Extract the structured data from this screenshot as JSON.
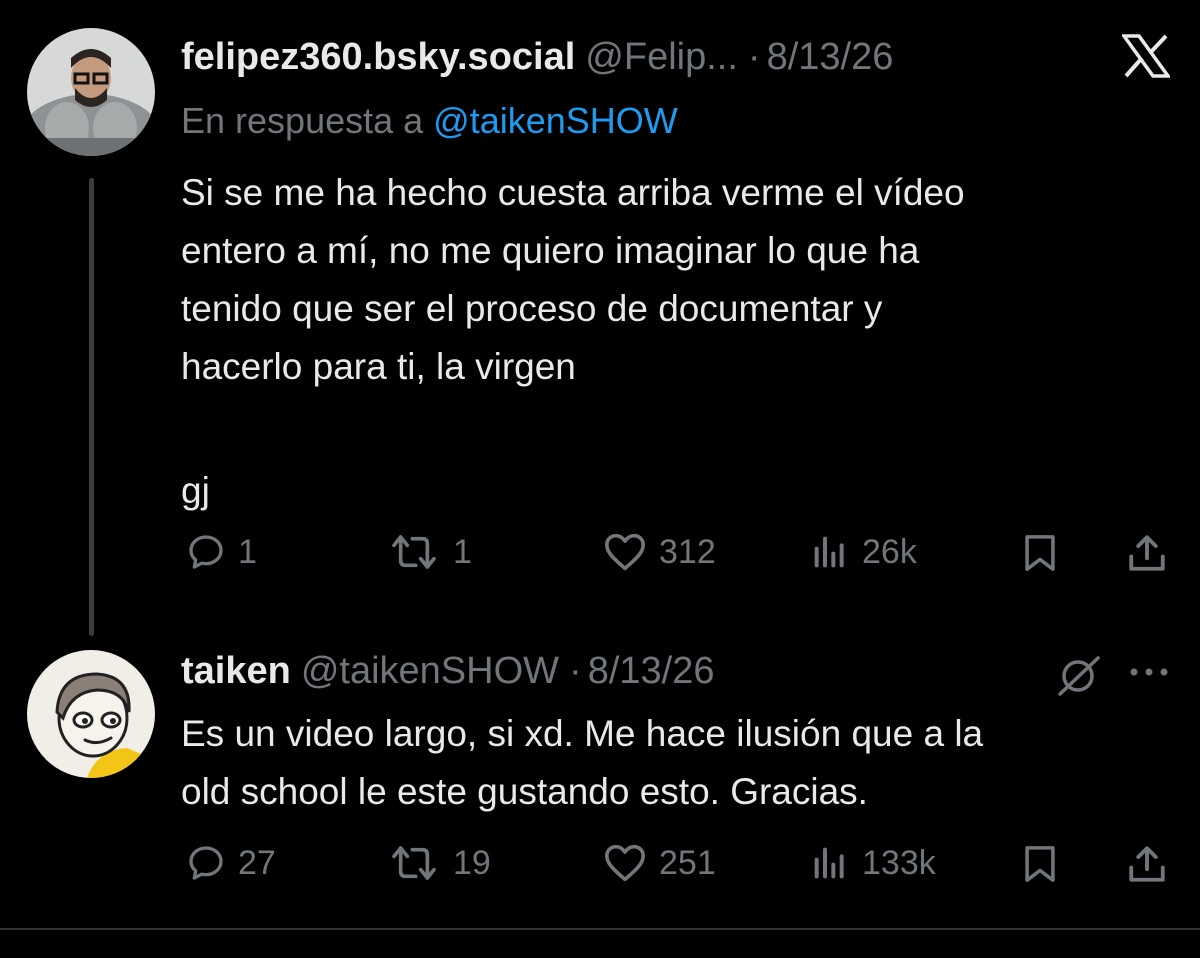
{
  "colors": {
    "background": "#000000",
    "text": "#e7e9ea",
    "muted": "#71767b",
    "link": "#1d9bf0",
    "thread": "#3a3d40"
  },
  "brand_icon": "x-logo-icon",
  "tweet1": {
    "display_name": "felipez360.bsky.social",
    "handle": "@Felip...",
    "separator": "·",
    "date": "8/13/26",
    "reply_prefix": "En respuesta a",
    "reply_mention": "@taikenSHOW",
    "body_lines": [
      "Si se me ha hecho cuesta arriba verme el vídeo",
      "entero a mí, no me quiero imaginar lo que ha",
      "tenido que ser el proceso de documentar y",
      "hacerlo para ti, la virgen"
    ],
    "body_extra": "gj",
    "stats": {
      "replies": "1",
      "reposts": "1",
      "likes": "312",
      "views": "26k"
    }
  },
  "tweet2": {
    "display_name": "taiken",
    "handle": "@taikenSHOW",
    "separator": "·",
    "date": "8/13/26",
    "body_lines": [
      "Es un video largo, si xd. Me hace ilusión que a la",
      "old school le este gustando esto. Gracias."
    ],
    "stats": {
      "replies": "27",
      "reposts": "19",
      "likes": "251",
      "views": "133k"
    }
  }
}
